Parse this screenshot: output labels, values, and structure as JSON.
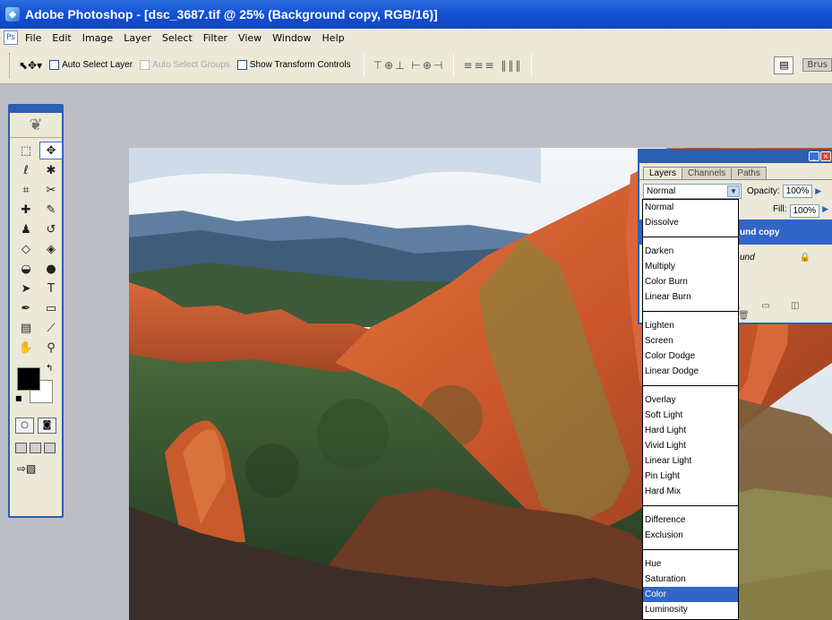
{
  "window": {
    "title": "Adobe Photoshop - [dsc_3687.tif @ 25% (Background copy, RGB/16)]"
  },
  "menu": [
    "File",
    "Edit",
    "Image",
    "Layer",
    "Select",
    "Filter",
    "View",
    "Window",
    "Help"
  ],
  "options": {
    "auto_select_layer": "Auto Select Layer",
    "auto_select_groups": "Auto Select Groups",
    "show_transform_controls": "Show Transform Controls",
    "brushes_tab": "Brus"
  },
  "layers_panel": {
    "tabs": [
      "Layers",
      "Channels",
      "Paths"
    ],
    "blend_mode": "Normal",
    "opacity_label": "Opacity:",
    "opacity_value": "100%",
    "fill_label": "Fill:",
    "fill_value": "100%",
    "layers": [
      {
        "name": "und copy",
        "selected": true
      },
      {
        "name": "und",
        "selected": false
      }
    ]
  },
  "blend_modes": [
    [
      "Normal",
      "Dissolve"
    ],
    [
      "Darken",
      "Multiply",
      "Color Burn",
      "Linear Burn"
    ],
    [
      "Lighten",
      "Screen",
      "Color Dodge",
      "Linear Dodge"
    ],
    [
      "Overlay",
      "Soft Light",
      "Hard Light",
      "Vivid Light",
      "Linear Light",
      "Pin Light",
      "Hard Mix"
    ],
    [
      "Difference",
      "Exclusion"
    ],
    [
      "Hue",
      "Saturation",
      "Color",
      "Luminosity"
    ]
  ],
  "blend_selected": "Color",
  "colors": {
    "titlebar": "#1552d6",
    "panel": "#ece9d8",
    "selection": "#3165c6",
    "workspace": "#bdbdc5"
  }
}
